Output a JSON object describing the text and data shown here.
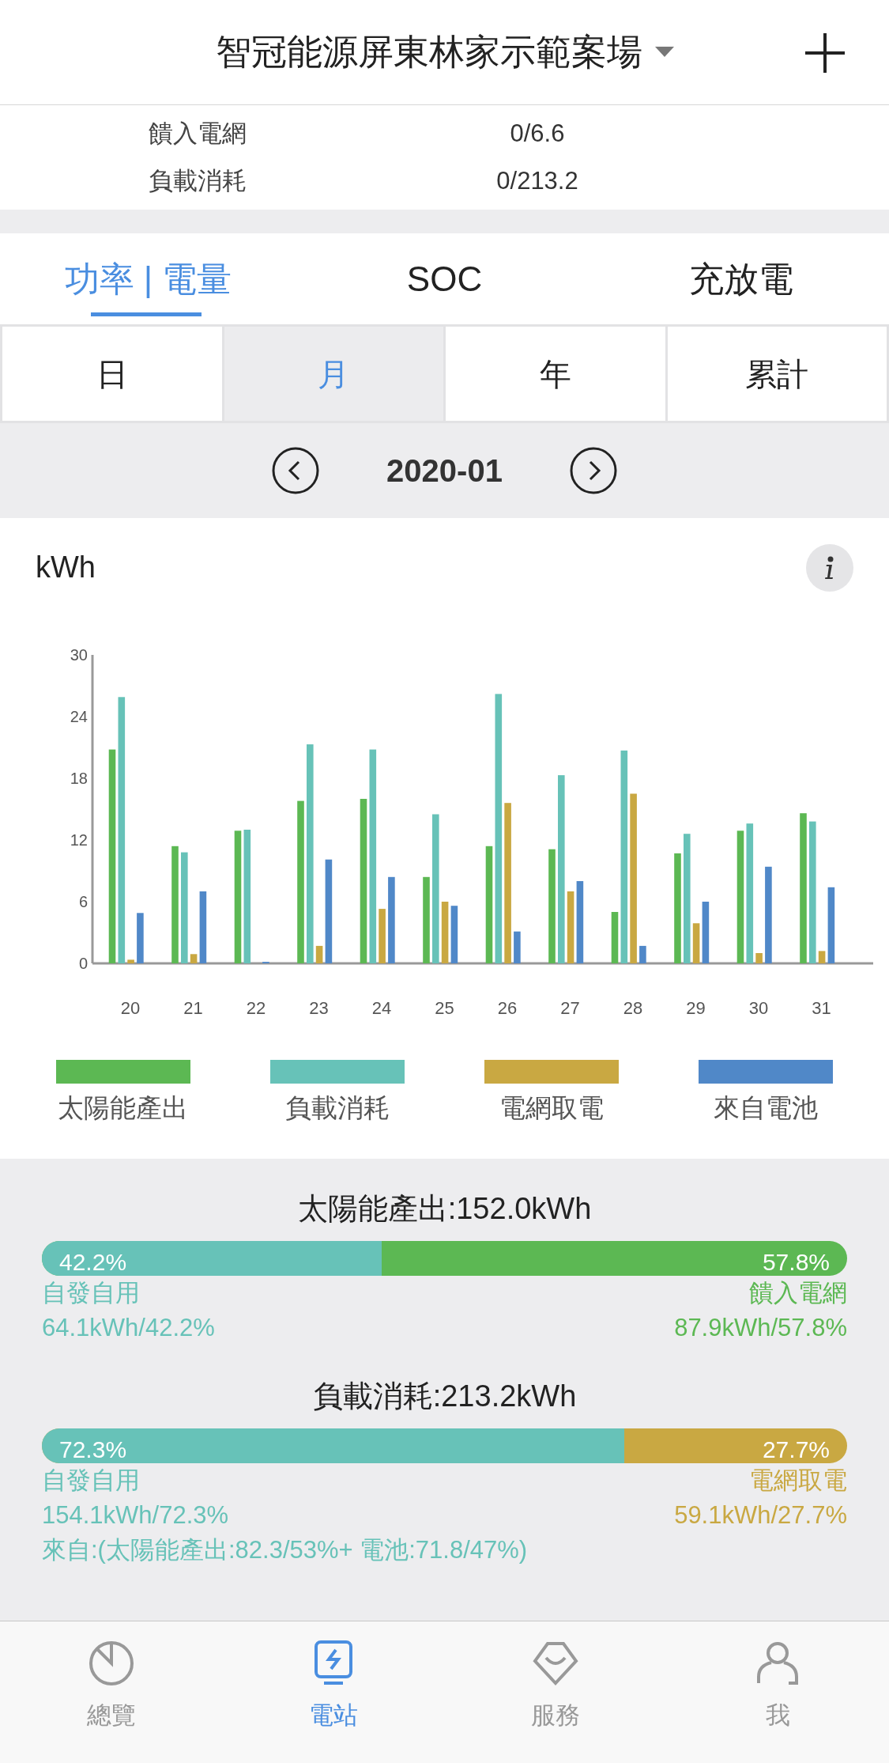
{
  "header": {
    "title": "智冠能源屏東林家示範案場"
  },
  "summary_rows": [
    {
      "label": "饋入電網",
      "value": "0/6.6"
    },
    {
      "label": "負載消耗",
      "value": "0/213.2"
    }
  ],
  "tabs": [
    {
      "label": "功率 | 電量",
      "selected": true
    },
    {
      "label": "SOC",
      "selected": false
    },
    {
      "label": "充放電",
      "selected": false
    }
  ],
  "periods": [
    {
      "label": "日",
      "selected": false
    },
    {
      "label": "月",
      "selected": true
    },
    {
      "label": "年",
      "selected": false
    },
    {
      "label": "累計",
      "selected": false
    }
  ],
  "date_nav": {
    "date": "2020-01"
  },
  "chart": {
    "unit": "kWh",
    "chart_data": {
      "type": "bar",
      "categories": [
        "20",
        "21",
        "22",
        "23",
        "24",
        "25",
        "26",
        "27",
        "28",
        "29",
        "30",
        "31"
      ],
      "ylim": [
        0,
        30
      ],
      "yticks": [
        0,
        6,
        12,
        18,
        24,
        30
      ],
      "series": [
        {
          "name": "太陽能產出",
          "color": "#5cb853",
          "values": [
            20.8,
            11.4,
            12.9,
            15.8,
            16.0,
            8.4,
            11.4,
            11.1,
            5.0,
            10.7,
            12.9,
            14.6
          ]
        },
        {
          "name": "負載消耗",
          "color": "#67c2b8",
          "values": [
            25.9,
            10.8,
            13.0,
            21.3,
            20.8,
            14.5,
            26.2,
            18.3,
            20.7,
            12.6,
            13.6,
            13.8
          ]
        },
        {
          "name": "電網取電",
          "color": "#c9a842",
          "values": [
            0.35,
            0.9,
            0,
            1.7,
            5.3,
            6.0,
            15.6,
            7.0,
            16.5,
            3.9,
            1.0,
            1.2
          ]
        },
        {
          "name": "來自電池",
          "color": "#5088c8",
          "values": [
            4.9,
            7.0,
            0.15,
            10.1,
            8.4,
            5.6,
            3.1,
            8.0,
            1.7,
            6.0,
            9.4,
            7.4
          ]
        }
      ]
    }
  },
  "stats": [
    {
      "title": "太陽能產出:152.0kWh",
      "level": 0.422,
      "segments": [
        {
          "color": "#67c2b8",
          "pct": "42.2%",
          "label": "自發自用",
          "value": "64.1kWh/42.2%"
        },
        {
          "color": "#5cb853",
          "pct": "57.8%",
          "label": "饋入電網",
          "value": "87.9kWh/57.8%"
        }
      ]
    },
    {
      "title": "負載消耗:213.2kWh",
      "level": 0.723,
      "segments": [
        {
          "color": "#67c2b8",
          "pct": "72.3%",
          "label": "自發自用",
          "value": "154.1kWh/72.3%"
        },
        {
          "color": "#c9a842",
          "pct": "27.7%",
          "label": "電網取電",
          "value": "59.1kWh/27.7%"
        }
      ],
      "note": "來自:(太陽能產出:82.3/53%+ 電池:71.8/47%)"
    }
  ],
  "bottom_nav": [
    {
      "label": "總覽",
      "kind": "overview",
      "selected": false
    },
    {
      "label": "電站",
      "kind": "station",
      "selected": true
    },
    {
      "label": "服務",
      "kind": "service",
      "selected": false
    },
    {
      "label": "我",
      "kind": "profile",
      "selected": false
    }
  ]
}
